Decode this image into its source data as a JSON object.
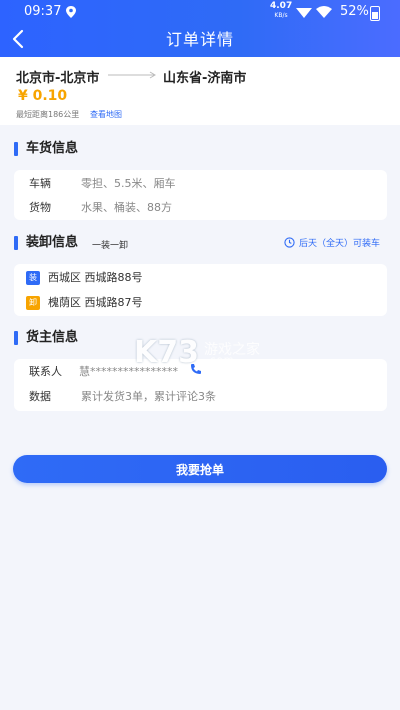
{
  "status_bar": {
    "time": "09:37",
    "network_speed": "4.07",
    "network_unit": "KB/s",
    "battery": "52%"
  },
  "header": {
    "title": "订单详情"
  },
  "route": {
    "from": "北京市-北京市",
    "to": "山东省-济南市",
    "price": "¥ 0.10",
    "distance": "最短距离186公里",
    "map_link": "查看地图"
  },
  "cargo": {
    "title": "车货信息",
    "vehicle_label": "车辆",
    "vehicle_value": "零担、5.5米、厢车",
    "goods_label": "货物",
    "goods_value": "水果、桶装、88方"
  },
  "loading": {
    "title": "装卸信息",
    "subtitle": "一装一卸",
    "time": "后天（全天）可装车",
    "load_tag": "装",
    "load_address": "西城区 西城路88号",
    "unload_tag": "卸",
    "unload_address": "槐荫区 西城路87号"
  },
  "owner": {
    "title": "货主信息",
    "contact_label": "联系人",
    "contact_value": "慧****************",
    "data_label": "数据",
    "data_value": "累计发货3单，累计评论3条"
  },
  "watermark": {
    "logo": "K73",
    "text": "游戏之家",
    "sub": ".com"
  },
  "actions": {
    "grab_label": "我要抢单"
  },
  "colors": {
    "primary": "#2f6bf6",
    "price": "#f7a400",
    "background": "#f3f5fb"
  }
}
